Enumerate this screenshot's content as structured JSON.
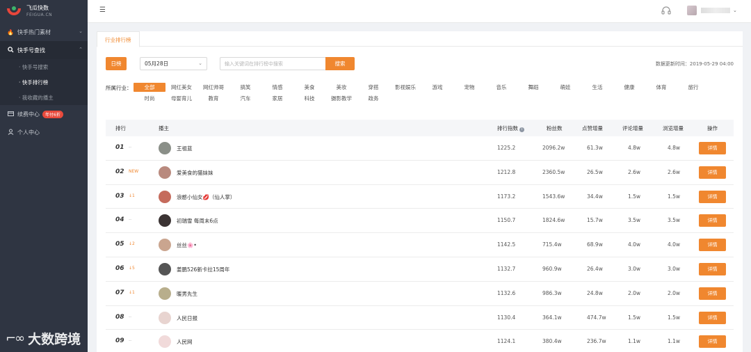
{
  "app": {
    "name": "飞瓜快数",
    "sub": "FEIGUA.CN"
  },
  "sidebar": {
    "groups": [
      {
        "label": "快手热门素材",
        "icon": "flame-icon",
        "chev": "⌄"
      },
      {
        "label": "快手号查找",
        "icon": "search-icon",
        "chev": "⌃"
      }
    ],
    "subitems": [
      "· 快手号搜索",
      "· 快手排行榜",
      "· 我收藏的播主"
    ],
    "renew_label": "续费中心",
    "renew_badge": "年付6折",
    "user_center": "个人中心"
  },
  "watermark": {
    "mark": "⌐∞",
    "text": "大数跨境"
  },
  "topbar": {
    "menu_icon": "☰"
  },
  "tabs": {
    "active": "行业排行榜"
  },
  "filters": {
    "day_btn": "日榜",
    "date": "05月28日",
    "date_caret": "⌄",
    "search_placeholder": "输入关键词在排行榜中搜索",
    "search_btn": "搜索",
    "updated": "数据更新时间：2019-05-29 04:00"
  },
  "industry": {
    "label": "所属行业：",
    "row1": [
      "全部",
      "网红美女",
      "网红帅哥",
      "搞笑",
      "情感",
      "美食",
      "美妆",
      "穿搭",
      "影视娱乐",
      "游戏",
      "宠物",
      "音乐",
      "舞蹈",
      "萌娃",
      "生活",
      "健康",
      "体育",
      "旅行"
    ],
    "row2": [
      "时尚",
      "母婴育儿",
      "教育",
      "汽车",
      "家居",
      "科技",
      "摄影教学",
      "政务"
    ]
  },
  "table": {
    "headers": {
      "rank": "排行",
      "host": "播主",
      "index": "排行指数",
      "info": "i",
      "fans": "粉丝数",
      "likes": "点赞增量",
      "comments": "评论增量",
      "views": "浏览增量",
      "op": "操作"
    },
    "detail_label": "详情",
    "rows": [
      {
        "rank": "01",
        "change": "--",
        "name": "王祖蓝",
        "index": "1225.2",
        "fans": "2096.2w",
        "likes": "61.3w",
        "comments": "4.8w",
        "views": "4.8w",
        "avatar": "#8a8f88"
      },
      {
        "rank": "02",
        "change": "NEW",
        "name": "爱美食的猫妹妹",
        "index": "1212.8",
        "fans": "2360.5w",
        "likes": "26.5w",
        "comments": "2.6w",
        "views": "2.6w",
        "avatar": "#b98a7e"
      },
      {
        "rank": "03",
        "change": "↓1",
        "name": "浪憨小仙女💋（仙人掌）",
        "index": "1173.2",
        "fans": "1543.6w",
        "likes": "34.4w",
        "comments": "1.5w",
        "views": "1.5w",
        "avatar": "#c56b5c"
      },
      {
        "rank": "04",
        "change": "--",
        "name": "初瑞雪 每周末6点",
        "index": "1150.7",
        "fans": "1824.6w",
        "likes": "15.7w",
        "comments": "3.5w",
        "views": "3.5w",
        "avatar": "#3b3333"
      },
      {
        "rank": "05",
        "change": "↓2",
        "name": "丝丝🌸•",
        "index": "1142.5",
        "fans": "715.4w",
        "likes": "68.9w",
        "comments": "4.0w",
        "views": "4.0w",
        "avatar": "#caa58f"
      },
      {
        "rank": "06",
        "change": "↓5",
        "name": "姜鹏526新卡拉15周年",
        "index": "1132.7",
        "fans": "960.9w",
        "likes": "26.4w",
        "comments": "3.0w",
        "views": "3.0w",
        "avatar": "#555555"
      },
      {
        "rank": "07",
        "change": "↓1",
        "name": "暖男先生",
        "index": "1132.6",
        "fans": "986.3w",
        "likes": "24.8w",
        "comments": "2.0w",
        "views": "2.0w",
        "avatar": "#b8ae8c"
      },
      {
        "rank": "08",
        "change": "--",
        "name": "人民日报",
        "index": "1130.4",
        "fans": "364.1w",
        "likes": "474.7w",
        "comments": "1.5w",
        "views": "1.5w",
        "avatar": "#e8d4d0"
      },
      {
        "rank": "09",
        "change": "--",
        "name": "人民网",
        "index": "1124.1",
        "fans": "380.4w",
        "likes": "236.7w",
        "comments": "1.1w",
        "views": "1.1w",
        "avatar": "#f1dada"
      }
    ]
  }
}
